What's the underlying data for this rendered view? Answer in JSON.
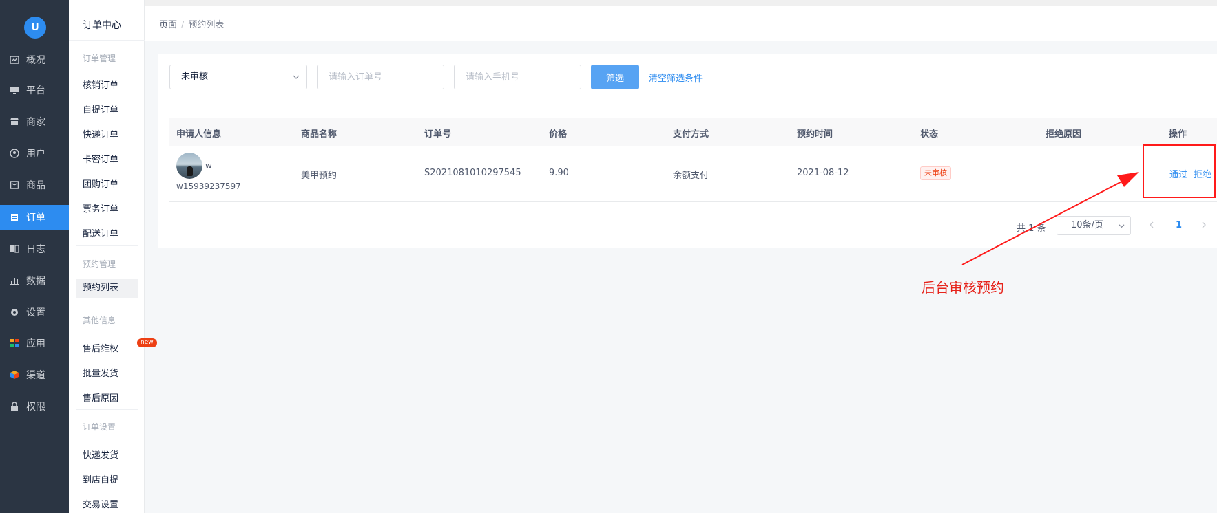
{
  "app": {
    "logo_text": "U"
  },
  "main_nav": {
    "items": [
      {
        "label": "概况",
        "icon": "overview-icon"
      },
      {
        "label": "平台",
        "icon": "monitor-icon"
      },
      {
        "label": "商家",
        "icon": "store-icon"
      },
      {
        "label": "用户",
        "icon": "user-icon"
      },
      {
        "label": "商品",
        "icon": "goods-icon"
      },
      {
        "label": "订单",
        "icon": "order-icon",
        "active": true
      },
      {
        "label": "日志",
        "icon": "log-icon"
      },
      {
        "label": "数据",
        "icon": "chart-icon"
      },
      {
        "label": "设置",
        "icon": "gear-icon"
      },
      {
        "label": "应用",
        "icon": "apps-icon"
      },
      {
        "label": "渠道",
        "icon": "channel-icon"
      },
      {
        "label": "权限",
        "icon": "lock-icon"
      }
    ]
  },
  "sub_nav": {
    "title": "订单中心",
    "groups": [
      {
        "label": "订单管理",
        "items": [
          "核销订单",
          "自提订单",
          "快递订单",
          "卡密订单",
          "团购订单",
          "票务订单",
          "配送订单"
        ]
      },
      {
        "label": "预约管理",
        "items": [
          "预约列表"
        ]
      },
      {
        "label": "其他信息",
        "items": [
          "售后维权",
          "批量发货",
          "售后原因"
        ]
      },
      {
        "label": "订单设置",
        "items": [
          "快递发货",
          "到店自提",
          "交易设置"
        ]
      }
    ],
    "new_badge": "new"
  },
  "breadcrumb": {
    "root": "页面",
    "separator": "/",
    "current": "预约列表"
  },
  "filters": {
    "status_selected": "未审核",
    "order_placeholder": "请输入订单号",
    "phone_placeholder": "请输入手机号",
    "filter_button": "筛选",
    "clear_link": "清空筛选条件"
  },
  "table": {
    "columns": [
      "申请人信息",
      "商品名称",
      "订单号",
      "价格",
      "支付方式",
      "预约时间",
      "状态",
      "拒绝原因",
      "操作"
    ],
    "rows": [
      {
        "applicant_name": "w",
        "applicant_phone": "w15939237597",
        "product": "美甲预约",
        "order_no": "S2021081010297545",
        "price": "9.90",
        "payment": "余额支付",
        "date": "2021-08-12",
        "status": "未审核",
        "reject_reason": "",
        "actions": {
          "approve": "通过",
          "reject": "拒绝"
        }
      }
    ]
  },
  "pagination": {
    "total_text": "共 1 条",
    "page_size": "10条/页",
    "current_page": "1"
  },
  "annotation": {
    "text": "后台审核预约",
    "color": "#e6231b"
  },
  "colors": {
    "primary": "#2d8cf0",
    "sidebar": "#2b3543",
    "danger": "#ed4014"
  }
}
